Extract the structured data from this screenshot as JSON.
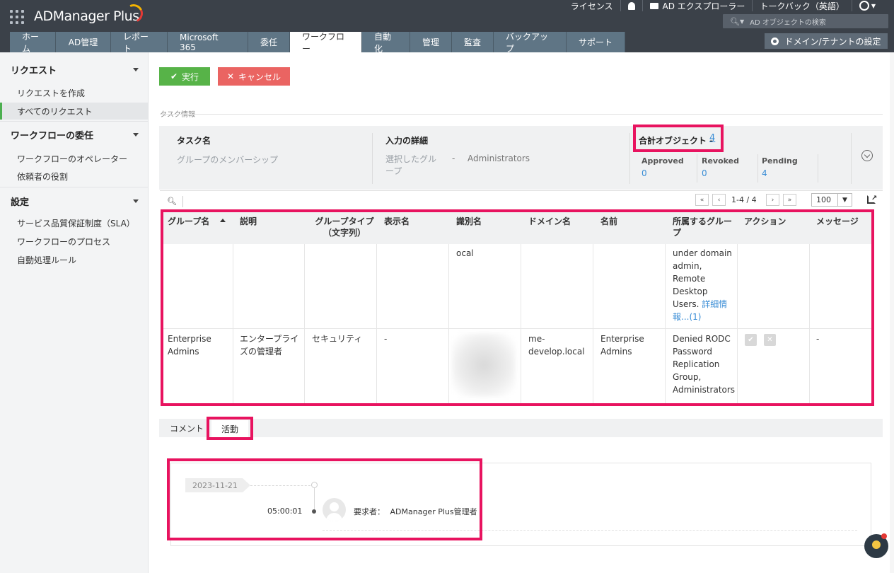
{
  "app": {
    "name": "ADManager Plus"
  },
  "toplinks": {
    "license": "ライセンス",
    "ad_explorer": "AD エクスプローラー",
    "talkback": "トークバック（英語）"
  },
  "search": {
    "placeholder": "AD オブジェクトの検索"
  },
  "nav": {
    "tabs": [
      "ホーム",
      "AD管理",
      "レポート",
      "Microsoft 365",
      "委任",
      "ワークフロー",
      "自動化",
      "管理",
      "監査",
      "バックアップ",
      "サポート"
    ],
    "active": "ワークフロー",
    "domain_button": "ドメイン/テナントの設定"
  },
  "sidebar": {
    "sections": [
      {
        "title": "リクエスト",
        "items": [
          "リクエストを作成",
          "すべてのリクエスト"
        ]
      },
      {
        "title": "ワークフローの委任",
        "items": [
          "ワークフローのオペレーター",
          "依頼者の役割"
        ]
      },
      {
        "title": "設定",
        "items": [
          "サービス品質保証制度（SLA）",
          "ワークフローのプロセス",
          "自動処理ルール"
        ]
      }
    ],
    "active_item": "すべてのリクエスト"
  },
  "actions": {
    "run": "実行",
    "cancel": "キャンセル"
  },
  "task_info": {
    "section_label": "タスク情報",
    "task_name_label": "タスク名",
    "task_name_value": "グループのメンバーシップ",
    "input_label": "入力の詳細",
    "input_key": "選択したグループ",
    "input_sep": "-",
    "input_value": "Administrators",
    "total_label": "合計オブジェクト -",
    "total_value": "4",
    "stats": [
      {
        "label": "Approved",
        "value": "0"
      },
      {
        "label": "Revoked",
        "value": "0"
      },
      {
        "label": "Pending",
        "value": "4"
      }
    ]
  },
  "pager": {
    "info": "1-4 / 4",
    "page_size": "100"
  },
  "table": {
    "columns": [
      "グループ名",
      "説明",
      "グループタイプ（文字列）",
      "表示名",
      "識別名",
      "ドメイン名",
      "名前",
      "所属するグループ",
      "アクション",
      "メッセージ"
    ],
    "partial_row": {
      "dn_tail": "ocal",
      "groups_text": "under domain admin, Remote Desktop Users.",
      "more_link": "詳細情報...(1)"
    },
    "row": {
      "group_name": "Enterprise Admins",
      "description": "エンタープライズの管理者",
      "group_type": "セキュリティ",
      "display_name": "-",
      "domain": "me-develop.local",
      "name": "Enterprise Admins",
      "member_of": "Denied RODC Password Replication Group, Administrators",
      "message": "-"
    }
  },
  "comment_tabs": {
    "comment": "コメント",
    "activity": "活動"
  },
  "activity": {
    "date": "2023-11-21",
    "time": "05:00:01",
    "requester_label": "要求者：",
    "requester": "ADManager Plus管理者"
  },
  "colors": {
    "accent_highlight": "#e8135f",
    "run": "#57b348",
    "cancel": "#ea6462",
    "link": "#3b8ed6"
  }
}
